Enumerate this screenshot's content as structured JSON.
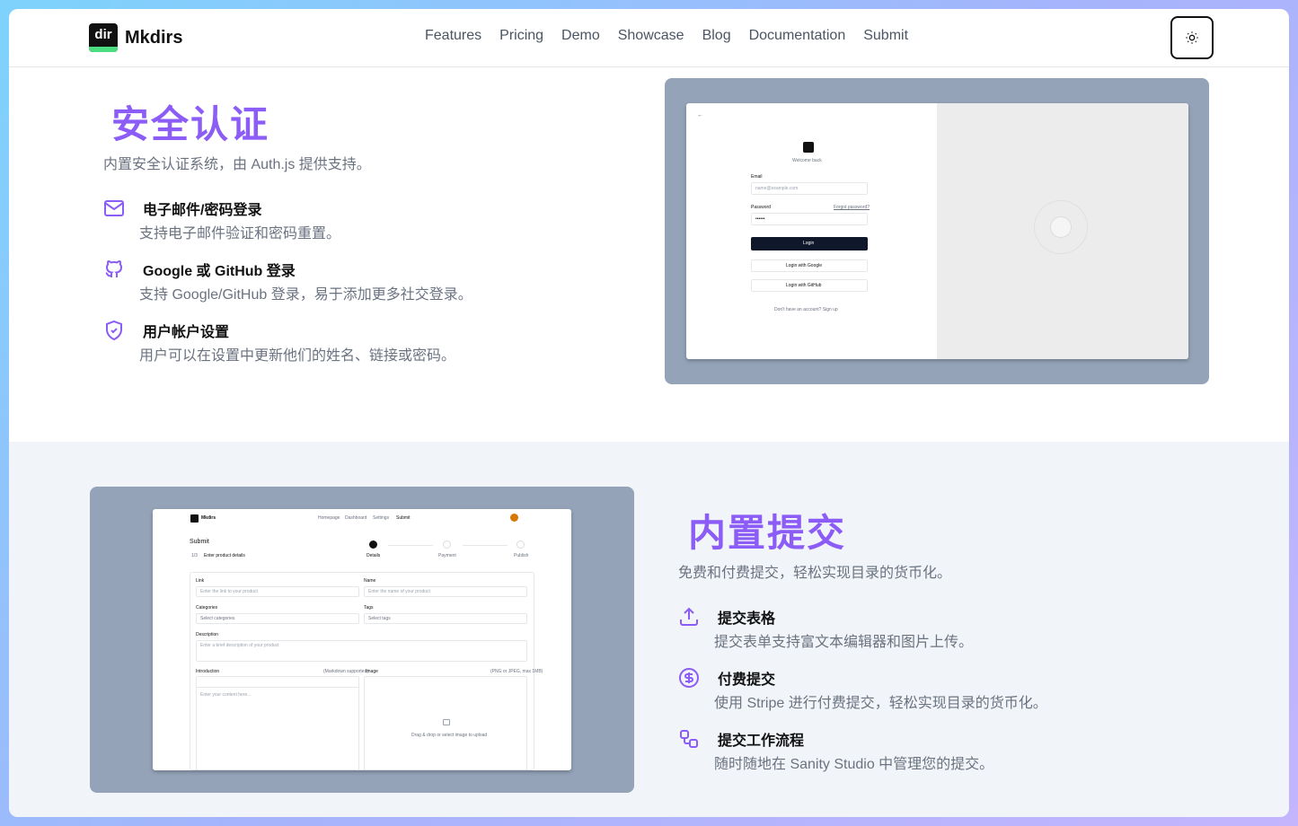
{
  "header": {
    "brand": "Mkdirs",
    "logo_text": "dir",
    "nav": [
      "Features",
      "Pricing",
      "Demo",
      "Showcase",
      "Blog",
      "Documentation",
      "Submit"
    ],
    "theme_icon": "sun-icon"
  },
  "section_auth": {
    "title": "安全认证",
    "description": "内置安全认证系统，由 Auth.js 提供支持。",
    "features": [
      {
        "icon": "mail-icon",
        "title": "电子邮件/密码登录",
        "desc": "支持电子邮件验证和密码重置。"
      },
      {
        "icon": "github-icon",
        "title": "Google 或 GitHub 登录",
        "desc": "支持 Google/GitHub 登录，易于添加更多社交登录。"
      },
      {
        "icon": "shield-check-icon",
        "title": "用户帐户设置",
        "desc": "用户可以在设置中更新他们的姓名、链接或密码。"
      }
    ],
    "screenshot": {
      "back": "←",
      "welcome": "Welcome back",
      "email_label": "Email",
      "email_placeholder": "name@example.com",
      "password_label": "Password",
      "forgot": "Forgot password?",
      "password_value": "••••••",
      "login_button": "Login",
      "google_button": "Login with Google",
      "github_button": "Login with GitHub",
      "signup": "Don't have an account? Sign up"
    }
  },
  "section_submit": {
    "title": "内置提交",
    "description": "免费和付费提交，轻松实现目录的货币化。",
    "features": [
      {
        "icon": "upload-icon",
        "title": "提交表格",
        "desc": "提交表单支持富文本编辑器和图片上传。"
      },
      {
        "icon": "dollar-circle-icon",
        "title": "付费提交",
        "desc": "使用 Stripe 进行付费提交，轻松实现目录的货币化。"
      },
      {
        "icon": "workflow-icon",
        "title": "提交工作流程",
        "desc": "随时随地在 Sanity Studio 中管理您的提交。"
      }
    ],
    "screenshot": {
      "brand": "Mkdirs",
      "nav": [
        "Homepage",
        "Dashboard",
        "Settings",
        "Submit"
      ],
      "heading": "Submit",
      "step_label": "1/3",
      "subheading": "Enter product details",
      "steps": [
        "Details",
        "Payment",
        "Publish"
      ],
      "link_label": "Link",
      "link_placeholder": "Enter the link to your product",
      "name_label": "Name",
      "name_placeholder": "Enter the name of your product",
      "categories_label": "Categories",
      "categories_placeholder": "Select categories",
      "tags_label": "Tags",
      "tags_placeholder": "Select tags",
      "description_label": "Description",
      "description_placeholder": "Enter a brief description of your product",
      "introduction_label": "Introduction",
      "markdown_note": "(Markdown supported)",
      "image_label": "Image",
      "image_note": "(PNG or JPEG, max 1MB)",
      "editor_placeholder": "Enter your content here...",
      "upload_hint": "Drag & drop or select image to upload"
    }
  }
}
